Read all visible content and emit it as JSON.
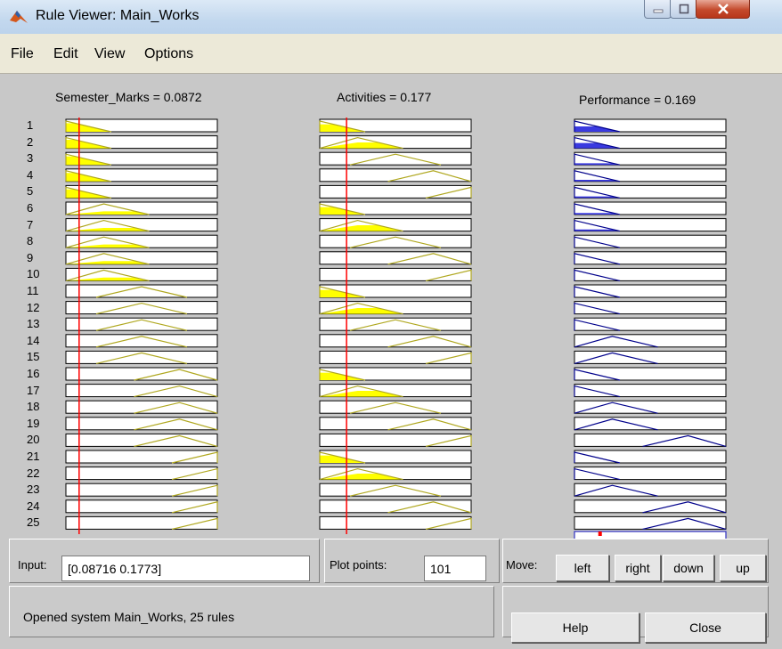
{
  "window": {
    "title": "Rule Viewer: Main_Works"
  },
  "menu": [
    "File",
    "Edit",
    "View",
    "Options"
  ],
  "columns": [
    {
      "header": "Semester_Marks = 0.0872"
    },
    {
      "header": "Activities = 0.177"
    },
    {
      "header": "Performance = 0.169"
    }
  ],
  "rules": [
    "1",
    "2",
    "3",
    "4",
    "5",
    "6",
    "7",
    "8",
    "9",
    "10",
    "11",
    "12",
    "13",
    "14",
    "15",
    "16",
    "17",
    "18",
    "19",
    "20",
    "21",
    "22",
    "23",
    "24",
    "25"
  ],
  "bottom": {
    "input_label": "Input:",
    "input_value": "[0.08716 0.1773]",
    "plot_points_label": "Plot points:",
    "plot_points_value": "101",
    "move_label": "Move:",
    "move_buttons": [
      "left",
      "right",
      "down",
      "up"
    ],
    "status": "Opened system Main_Works, 25 rules",
    "help_label": "Help",
    "close_label": "Close"
  },
  "colors": {
    "input_fill": "#ffff00",
    "output_fill": "#3a3ae0",
    "mf_line_input": "#b0a820",
    "mf_line_output": "#00008b",
    "index_line": "#ff0000"
  }
}
